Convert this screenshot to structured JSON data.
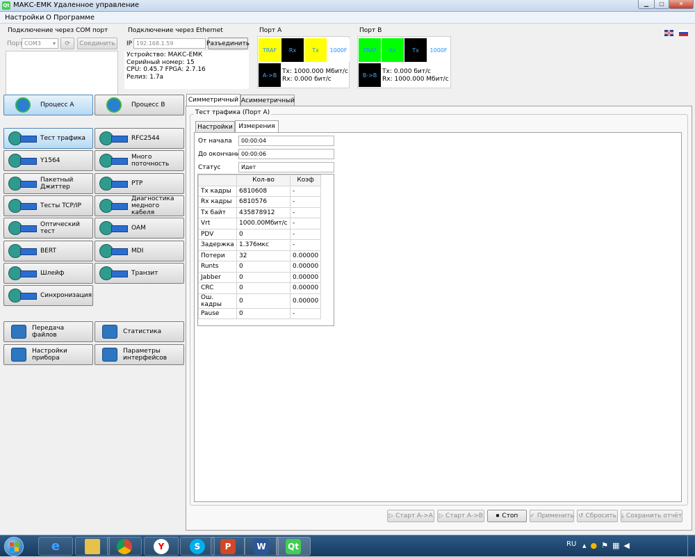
{
  "window": {
    "title": "МАКС-ЕМК Удаленное управление",
    "app_icon": "Qt"
  },
  "menu": {
    "items": [
      "Настройки",
      "О Программе"
    ]
  },
  "com": {
    "group_label": "Подключение через COM порт",
    "port_label": "Порт",
    "port_value": "COM3",
    "connect_label": "Соединить"
  },
  "ethernet": {
    "group_label": "Подключение через Ethernet",
    "ip_label": "IP",
    "ip_value": "192.168.1.59",
    "disconnect_label": "Разъединить",
    "device_info": [
      "Устройство: МАКС-ЕМК",
      "Серийный номер: 15",
      "CPU: 0.45.7 FPGA: 2.7.16",
      "Релиз: 1.7a"
    ]
  },
  "port_a": {
    "label": "Порт A",
    "cells": [
      "TRAF",
      "Rx",
      "Tx",
      "1000F",
      "A->B"
    ],
    "tx": "Tx: 1000.000 Мбит/с",
    "rx": "Rx: 0.000 бит/с"
  },
  "port_b": {
    "label": "Порт B",
    "cells": [
      "TRAF",
      "Rx",
      "Tx",
      "1000F",
      "B->B"
    ],
    "tx": "Tx: 0.000 бит/с",
    "rx": "Rx: 1000.000 Мбит/с"
  },
  "process": {
    "a": "Процесс A",
    "b": "Процесс B"
  },
  "tests": [
    [
      "Тест трафика",
      "RFC2544"
    ],
    [
      "Y1564",
      "Много поточность"
    ],
    [
      "Пакетный Джиттер",
      "PTP"
    ],
    [
      "Тесты TCP/IP",
      "Диагностика медного кабеля"
    ],
    [
      "Оптический тест",
      "OAM"
    ],
    [
      "BERT",
      "MDI"
    ],
    [
      "Шлейф",
      "Транзит"
    ],
    [
      "Синхронизация"
    ]
  ],
  "utils": [
    [
      "Передача файлов",
      "Статистика"
    ],
    [
      "Настройки прибора",
      "Параметры интерфейсов"
    ]
  ],
  "mode_tabs": [
    "Симметричный",
    "Асимметричный"
  ],
  "group_title": "Тест трафика (Порт A)",
  "sub_tabs": [
    "Настройки",
    "Измерения"
  ],
  "status": {
    "from_start_label": "От начала",
    "from_start": "00:00:04",
    "to_end_label": "До окончания",
    "to_end": "00:00:06",
    "status_label": "Статус",
    "status": "Идет"
  },
  "table": {
    "headers": [
      "",
      "Кол-во",
      "Коэф"
    ],
    "rows": [
      [
        "Tx кадры",
        "6810608",
        "-"
      ],
      [
        "Rx кадры",
        "6810576",
        "-"
      ],
      [
        "Tx байт",
        "435878912",
        "-"
      ],
      [
        "Vrt",
        "1000.00Мбит/с",
        "-"
      ],
      [
        "PDV",
        "0",
        "-"
      ],
      [
        "Задержка",
        "1.376мкс",
        "-"
      ],
      [
        "Потери",
        "32",
        "0.00000"
      ],
      [
        "Runts",
        "0",
        "0.00000"
      ],
      [
        "Jabber",
        "0",
        "0.00000"
      ],
      [
        "CRC",
        "0",
        "0.00000"
      ],
      [
        "Ош. кадры",
        "0",
        "0.00000"
      ],
      [
        "Pause",
        "0",
        "-"
      ]
    ]
  },
  "actions": [
    "Старт A->A",
    "Старт A->B",
    "Стоп",
    "Применить",
    "Сбросить",
    "Сохранить отчёт"
  ],
  "tray": {
    "lang": "RU"
  },
  "taskbar_apps": [
    "ie-icon",
    "explorer-icon",
    "chrome-icon",
    "yandex-icon",
    "skype-icon",
    "powerpoint-icon",
    "word-icon",
    "qt-icon"
  ],
  "colors": {
    "green": "#00ff00",
    "yellow": "#ffff00",
    "black": "#000000",
    "blue_text": "#1e90ff"
  }
}
